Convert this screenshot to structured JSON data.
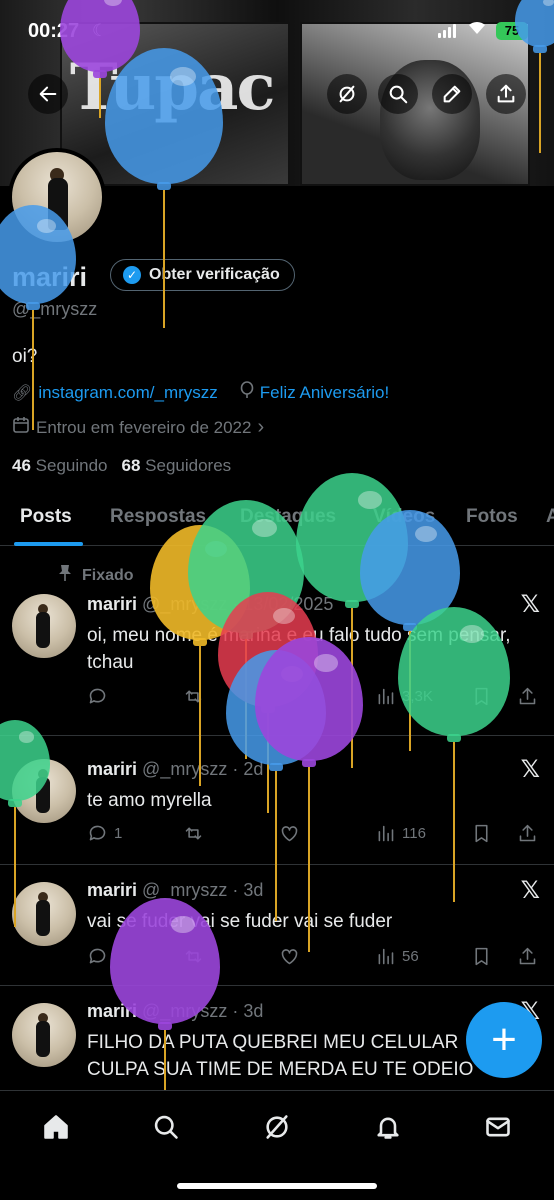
{
  "status_bar": {
    "time": "00:27",
    "battery": "75"
  },
  "profile": {
    "name": "mariri",
    "verify_label": "Obter verificação",
    "handle": "@_mryszz",
    "bio": "oi?",
    "link": "instagram.com/_mryszz",
    "birthday": "Feliz Aniversário!",
    "joined": "Entrou em fevereiro de 2022",
    "following_count": "46",
    "following_label": "Seguindo",
    "followers_count": "68",
    "followers_label": "Seguidores"
  },
  "tabs": [
    "Posts",
    "Respostas",
    "Destaques",
    "Vídeos",
    "Fotos",
    "A"
  ],
  "pinned_label": "Fixado",
  "posts": [
    {
      "name": "mariri",
      "meta": "@_mryszz · 13/02/2025",
      "text": "oi, meu nome é marina e eu falo tudo sem pensar, tchau",
      "replies": "",
      "views": "3,3K"
    },
    {
      "name": "mariri",
      "meta": "@_mryszz · 2d",
      "text": "te amo myrella",
      "replies": "1",
      "views": "116"
    },
    {
      "name": "mariri",
      "meta": "@_mryszz · 3d",
      "text": "vai se fuder vai se fuder vai se fuder",
      "replies": "",
      "views": "56"
    },
    {
      "name": "mariri",
      "meta": "@_mryszz · 3d",
      "text": "FILHO DA PUTA QUEBREI MEU CELULAR CULPA SUA TIME DE MERDA EU TE ODEIO",
      "replies": "",
      "views": ""
    }
  ],
  "icons": {
    "back": "arrow-left-icon",
    "grok": "grok-icon",
    "search": "search-icon",
    "edit": "edit-icon",
    "share": "share-icon",
    "fab": "plus-icon",
    "home": "home-icon",
    "notifications": "bell-icon",
    "messages": "mail-icon"
  },
  "colors": {
    "accent": "#1d9bf0",
    "background": "#000000",
    "muted": "#71767b",
    "battery": "#34c759"
  },
  "fab_label": "+"
}
